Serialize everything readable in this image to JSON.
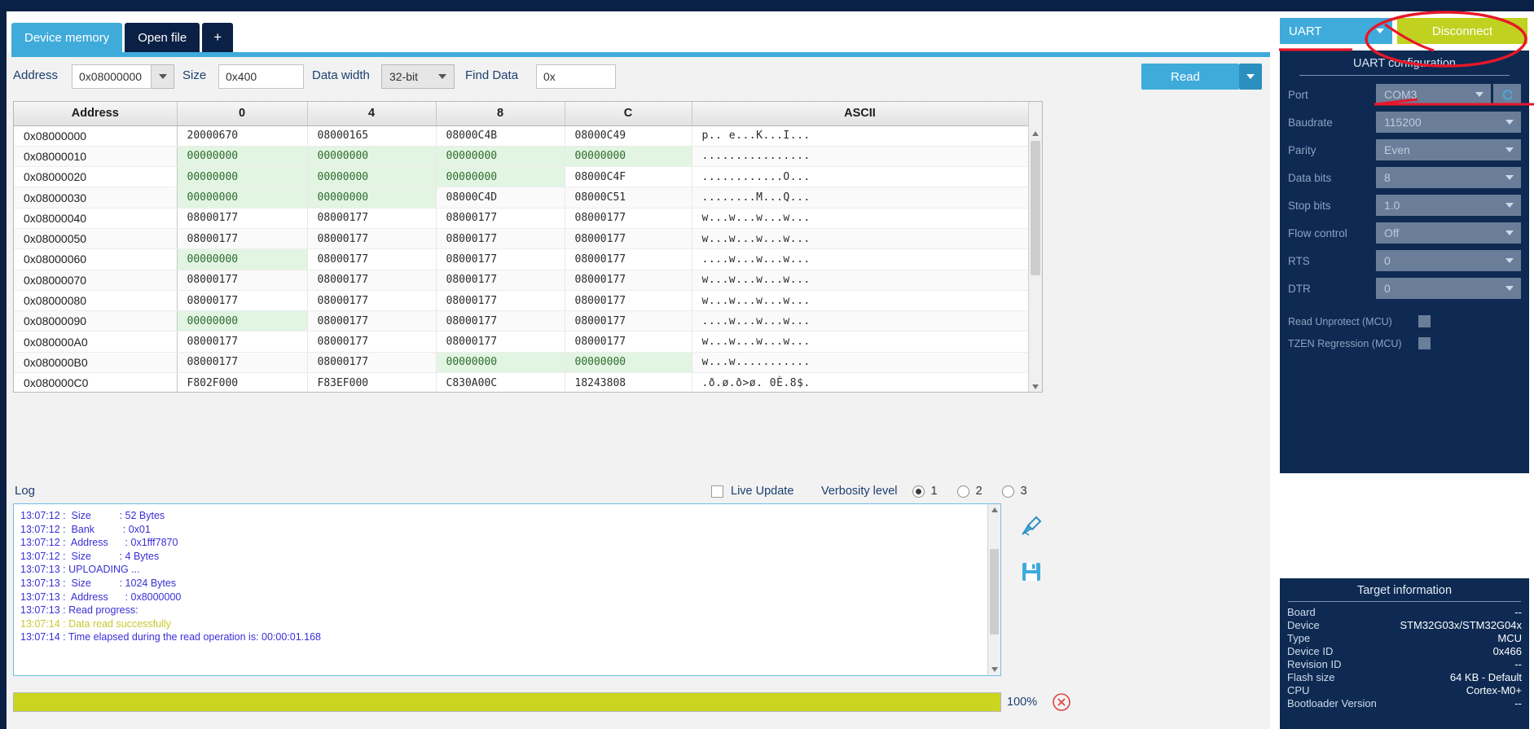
{
  "tabs": [
    {
      "label": "Device memory",
      "active": true
    },
    {
      "label": "Open file",
      "active": false
    },
    {
      "label": "+",
      "active": false
    }
  ],
  "toolbar": {
    "address_label": "Address",
    "address_value": "0x08000000",
    "size_label": "Size",
    "size_value": "0x400",
    "data_width_label": "Data width",
    "data_width_value": "32-bit",
    "find_data_label": "Find Data",
    "find_data_value": "0x",
    "read_label": "Read"
  },
  "memory_table": {
    "headers": [
      "Address",
      "0",
      "4",
      "8",
      "C",
      "ASCII"
    ],
    "rows": [
      {
        "addr": "0x08000000",
        "c0": "20000670",
        "c4": "08000165",
        "c8": "08000C4B",
        "cc": "08000C49",
        "ascii": "p.. e...K...I...",
        "zeros": []
      },
      {
        "addr": "0x08000010",
        "c0": "00000000",
        "c4": "00000000",
        "c8": "00000000",
        "cc": "00000000",
        "ascii": "................",
        "zeros": [
          "c0",
          "c4",
          "c8",
          "cc"
        ]
      },
      {
        "addr": "0x08000020",
        "c0": "00000000",
        "c4": "00000000",
        "c8": "00000000",
        "cc": "08000C4F",
        "ascii": "............O...",
        "zeros": [
          "c0",
          "c4",
          "c8"
        ]
      },
      {
        "addr": "0x08000030",
        "c0": "00000000",
        "c4": "00000000",
        "c8": "08000C4D",
        "cc": "08000C51",
        "ascii": "........M...Q...",
        "zeros": [
          "c0",
          "c4"
        ]
      },
      {
        "addr": "0x08000040",
        "c0": "08000177",
        "c4": "08000177",
        "c8": "08000177",
        "cc": "08000177",
        "ascii": "w...w...w...w...",
        "zeros": []
      },
      {
        "addr": "0x08000050",
        "c0": "08000177",
        "c4": "08000177",
        "c8": "08000177",
        "cc": "08000177",
        "ascii": "w...w...w...w...",
        "zeros": []
      },
      {
        "addr": "0x08000060",
        "c0": "00000000",
        "c4": "08000177",
        "c8": "08000177",
        "cc": "08000177",
        "ascii": "....w...w...w...",
        "zeros": [
          "c0"
        ]
      },
      {
        "addr": "0x08000070",
        "c0": "08000177",
        "c4": "08000177",
        "c8": "08000177",
        "cc": "08000177",
        "ascii": "w...w...w...w...",
        "zeros": []
      },
      {
        "addr": "0x08000080",
        "c0": "08000177",
        "c4": "08000177",
        "c8": "08000177",
        "cc": "08000177",
        "ascii": "w...w...w...w...",
        "zeros": []
      },
      {
        "addr": "0x08000090",
        "c0": "00000000",
        "c4": "08000177",
        "c8": "08000177",
        "cc": "08000177",
        "ascii": "....w...w...w...",
        "zeros": [
          "c0"
        ]
      },
      {
        "addr": "0x080000A0",
        "c0": "08000177",
        "c4": "08000177",
        "c8": "08000177",
        "cc": "08000177",
        "ascii": "w...w...w...w...",
        "zeros": []
      },
      {
        "addr": "0x080000B0",
        "c0": "08000177",
        "c4": "08000177",
        "c8": "00000000",
        "cc": "00000000",
        "ascii": "w...w...........",
        "zeros": [
          "c8",
          "cc"
        ]
      },
      {
        "addr": "0x080000C0",
        "c0": "F802F000",
        "c4": "F83EF000",
        "c8": "C830A00C",
        "cc": "18243808",
        "ascii": ".ð.ø.ð>ø. 0È.8$.",
        "zeros": []
      }
    ]
  },
  "log_panel": {
    "title": "Log",
    "live_update_label": "Live Update",
    "live_update_checked": false,
    "verbosity_label": "Verbosity level",
    "verbosity_options": [
      "1",
      "2",
      "3"
    ],
    "verbosity_selected": "1",
    "lines": [
      {
        "text": "13:07:12 :  Size          : 52 Bytes",
        "type": "info"
      },
      {
        "text": "13:07:12 :  Bank          : 0x01",
        "type": "info"
      },
      {
        "text": "13:07:12 :  Address      : 0x1fff7870",
        "type": "info"
      },
      {
        "text": "13:07:12 :  Size          : 4 Bytes",
        "type": "info"
      },
      {
        "text": "13:07:13 : UPLOADING ...",
        "type": "info"
      },
      {
        "text": "13:07:13 :  Size          : 1024 Bytes",
        "type": "info"
      },
      {
        "text": "13:07:13 :  Address      : 0x8000000",
        "type": "info"
      },
      {
        "text": "13:07:13 : Read progress:",
        "type": "info"
      },
      {
        "text": "13:07:14 : Data read successfully",
        "type": "ok"
      },
      {
        "text": "13:07:14 : Time elapsed during the read operation is: 00:00:01.168",
        "type": "info"
      }
    ]
  },
  "progress": {
    "percent_label": "100%",
    "value": 100
  },
  "connection": {
    "interface": "UART",
    "disconnect_label": "Disconnect"
  },
  "uart_config": {
    "title": "UART configuration",
    "fields": [
      {
        "label": "Port",
        "value": "COM3",
        "refresh": true
      },
      {
        "label": "Baudrate",
        "value": "115200"
      },
      {
        "label": "Parity",
        "value": "Even"
      },
      {
        "label": "Data bits",
        "value": "8"
      },
      {
        "label": "Stop bits",
        "value": "1.0"
      },
      {
        "label": "Flow control",
        "value": "Off"
      },
      {
        "label": "RTS",
        "value": "0"
      },
      {
        "label": "DTR",
        "value": "0"
      }
    ],
    "checkboxes": [
      {
        "label": "Read Unprotect (MCU)",
        "checked": false
      },
      {
        "label": "TZEN Regression (MCU)",
        "checked": false
      }
    ]
  },
  "target_information": {
    "title": "Target information",
    "rows": [
      {
        "key": "Board",
        "value": "--"
      },
      {
        "key": "Device",
        "value": "STM32G03x/STM32G04x"
      },
      {
        "key": "Type",
        "value": "MCU"
      },
      {
        "key": "Device ID",
        "value": "0x466"
      },
      {
        "key": "Revision ID",
        "value": "--"
      },
      {
        "key": "Flash size",
        "value": "64 KB - Default"
      },
      {
        "key": "CPU",
        "value": "Cortex-M0+"
      },
      {
        "key": "Bootloader Version",
        "value": "--"
      }
    ]
  },
  "colors": {
    "accent_blue": "#3fabdb",
    "dark_navy": "#0b2045",
    "panel_navy": "#0e2a52",
    "lime": "#c0d11f",
    "annotation_red": "#e8172a",
    "zero_green": "#e2f5e2"
  }
}
